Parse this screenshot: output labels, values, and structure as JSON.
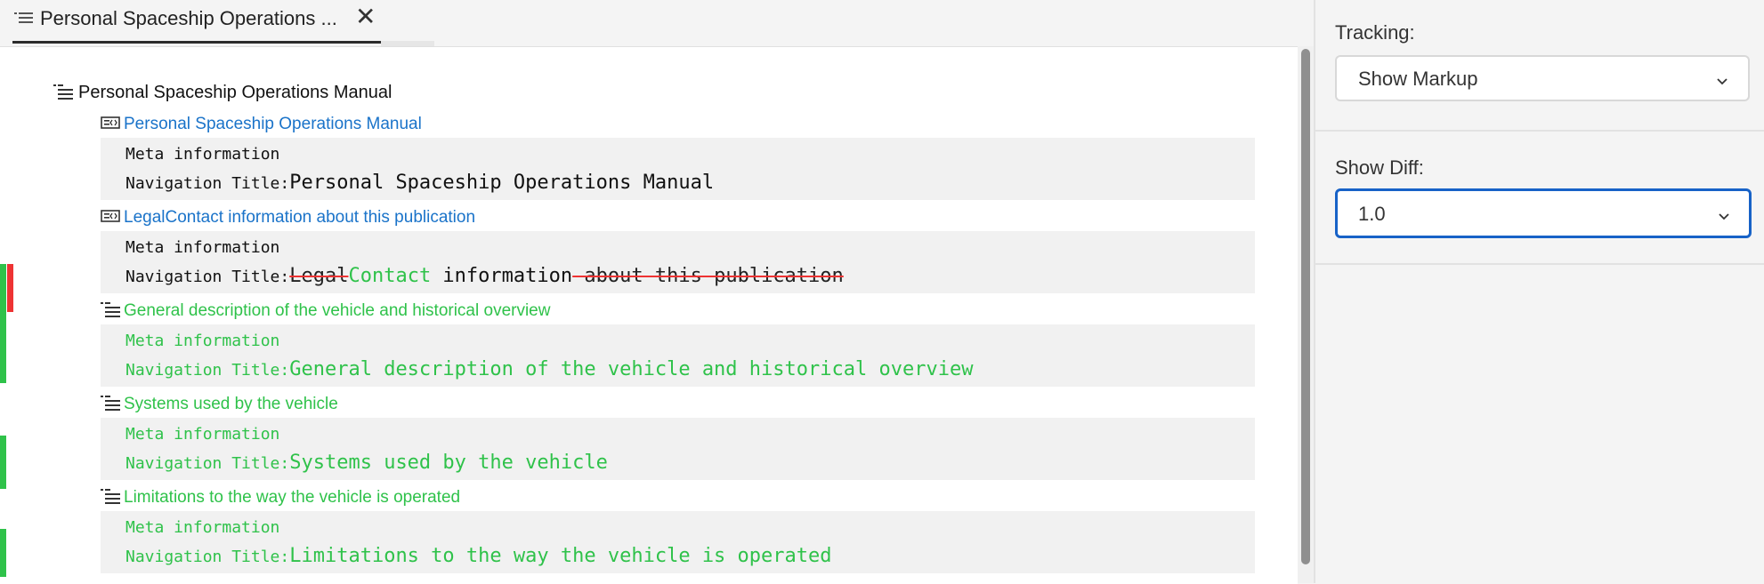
{
  "tab": {
    "label": "Personal Spaceship Operations ...",
    "close": "✕"
  },
  "tree": {
    "root_label": "Personal Spaceship Operations Manual",
    "meta_label": "Meta information",
    "nav_prefix": "Navigation Title:",
    "entries": [
      {
        "title": "Personal Spaceship Operations Manual",
        "nav": "Personal Spaceship Operations Manual",
        "status": "unchanged"
      },
      {
        "title": "LegalContact information about this publication",
        "nav_deleted": "Legal",
        "nav_inserted": "Contact",
        "nav_common": " information",
        "nav_deleted_tail": " about this publication",
        "status": "modified"
      },
      {
        "title": "General description of the vehicle and historical overview",
        "nav": "General description of the vehicle and historical overview",
        "status": "added"
      },
      {
        "title": "Systems used by the vehicle",
        "nav": "Systems used by the vehicle",
        "status": "added"
      },
      {
        "title": "Limitations to the way the vehicle is operated",
        "nav": "Limitations to the way the vehicle is operated",
        "status": "added"
      }
    ]
  },
  "panel": {
    "tracking_label": "Tracking:",
    "tracking_value": "Show Markup",
    "diff_label": "Show Diff:",
    "diff_value": "1.0"
  },
  "colors": {
    "added": "#2fc24a",
    "deleted": "#e33",
    "link": "#1a73c9",
    "focus": "#1762c7"
  },
  "icons": [
    "toc-icon",
    "topic-icon",
    "close-icon",
    "chevron-down-icon"
  ]
}
